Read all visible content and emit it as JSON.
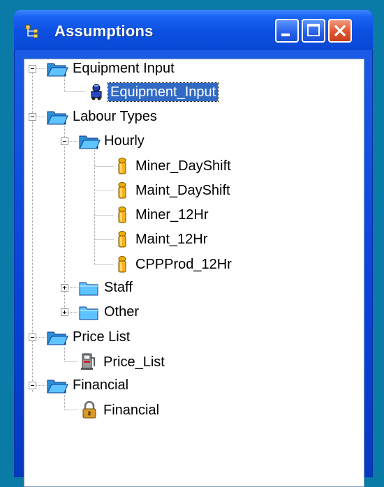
{
  "window": {
    "title": "Assumptions"
  },
  "titlebar_buttons": {
    "minimize_icon": "minimize-icon",
    "maximize_icon": "maximize-icon",
    "close_icon": "close-icon"
  },
  "tree": {
    "equipment_input": {
      "label": "Equipment Input",
      "children": [
        {
          "label": "Equipment_Input",
          "icon": "equipment-icon",
          "selected": true
        }
      ]
    },
    "labour_types": {
      "label": "Labour Types",
      "hourly": {
        "label": "Hourly",
        "children": [
          {
            "label": "Miner_DayShift",
            "icon": "worker-icon"
          },
          {
            "label": "Maint_DayShift",
            "icon": "worker-icon"
          },
          {
            "label": "Miner_12Hr",
            "icon": "worker-icon"
          },
          {
            "label": "Maint_12Hr",
            "icon": "worker-icon"
          },
          {
            "label": "CPPProd_12Hr",
            "icon": "worker-icon"
          }
        ]
      },
      "staff": {
        "label": "Staff"
      },
      "other": {
        "label": "Other"
      }
    },
    "price_list": {
      "label": "Price List",
      "children": [
        {
          "label": "Price_List",
          "icon": "fuel-pump-icon"
        }
      ]
    },
    "financial": {
      "label": "Financial",
      "children": [
        {
          "label": "Financial",
          "icon": "padlock-icon"
        }
      ]
    }
  },
  "colors": {
    "desktop": "#0a7aa6",
    "titlebar": "#0b4fe2",
    "selection": "#316ac5",
    "folder": "#2d8fd8"
  }
}
